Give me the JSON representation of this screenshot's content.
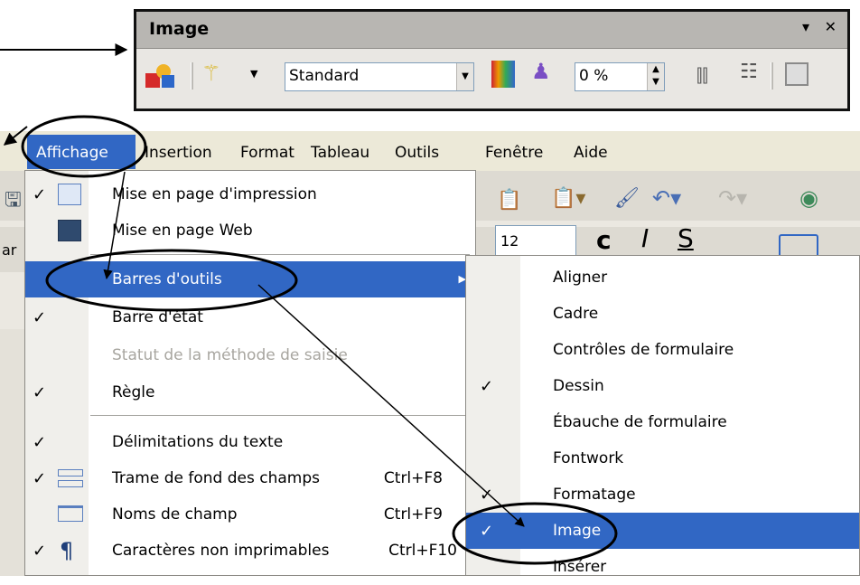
{
  "image_toolbar": {
    "title": "Image",
    "menu_glyph": "▾",
    "close_glyph": "✕",
    "filter_value": "Standard",
    "transparency_value": "0 %",
    "icons": [
      "image-filter-icon",
      "magic-wand-icon",
      "graphics-mode-select",
      "color-icon",
      "transparency-icon",
      "flip-vertical-icon",
      "flip-horizontal-icon",
      "frame-properties-icon"
    ]
  },
  "menubar": {
    "items": [
      "Affichage",
      "Insertion",
      "Format",
      "Tableau",
      "Outils",
      "Fenêtre",
      "Aide"
    ]
  },
  "background_toolbar": {
    "partial_text_left": "ar",
    "font_size": "12"
  },
  "view_menu": {
    "items": [
      {
        "label": "Mise en page d'impression",
        "checked": true,
        "icon": "print-layout-icon"
      },
      {
        "label": "Mise en page Web",
        "checked": false,
        "icon": "web-layout-icon"
      },
      {
        "label": "Barres d'outils",
        "submenu": true,
        "highlighted": true
      },
      {
        "label": "Barre d'état",
        "checked": true
      },
      {
        "label": "Statut de la méthode de saisie",
        "disabled": true
      },
      {
        "label": "Règle",
        "checked": true
      },
      {
        "label": "Délimitations du texte",
        "checked": true
      },
      {
        "label": "Trame de fond des champs",
        "checked": true,
        "shortcut": "Ctrl+F8",
        "icon": "field-shadings-icon"
      },
      {
        "label": "Noms de champ",
        "shortcut": "Ctrl+F9",
        "icon": "field-names-icon"
      },
      {
        "label": "Caractères non imprimables",
        "checked": true,
        "shortcut": "Ctrl+F10",
        "icon": "pilcrow-icon"
      }
    ]
  },
  "toolbars_submenu": {
    "items": [
      {
        "label": "Aligner"
      },
      {
        "label": "Cadre"
      },
      {
        "label": "Contrôles de formulaire"
      },
      {
        "label": "Dessin",
        "checked": true
      },
      {
        "label": "Ébauche de formulaire"
      },
      {
        "label": "Fontwork"
      },
      {
        "label": "Formatage",
        "checked": true
      },
      {
        "label": "Image",
        "checked": true,
        "highlighted": true
      },
      {
        "label": "Insérer"
      }
    ]
  },
  "colors": {
    "highlight": "#3167c4",
    "menubar_bg": "#ece9d8",
    "toolbar_title_bg": "#b8b6b2"
  }
}
